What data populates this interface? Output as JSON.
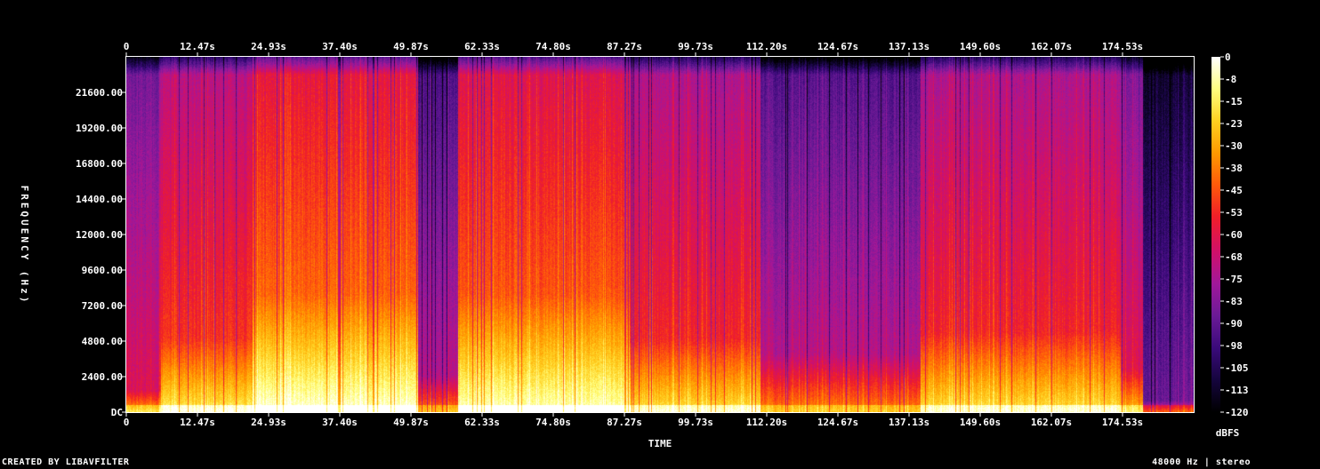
{
  "chart_data": {
    "type": "heatmap",
    "title": "",
    "xlabel": "TIME",
    "ylabel": "FREQUENCY (Hz)",
    "x_ticks": [
      "0",
      "12.47s",
      "24.93s",
      "37.40s",
      "49.87s",
      "62.33s",
      "74.80s",
      "87.27s",
      "99.73s",
      "112.20s",
      "124.67s",
      "137.13s",
      "149.60s",
      "162.07s",
      "174.53s"
    ],
    "y_ticks": [
      "DC",
      "2400.00",
      "4800.00",
      "7200.00",
      "9600.00",
      "12000.00",
      "14400.00",
      "16800.00",
      "19200.00",
      "21600.00"
    ],
    "y_range_hz": [
      0,
      24000
    ],
    "x_range_s": [
      0,
      186.9
    ],
    "colorbar": {
      "unit": "dBFS",
      "ticks": [
        "0",
        "-8",
        "-15",
        "-23",
        "-30",
        "-38",
        "-45",
        "-53",
        "-60",
        "-68",
        "-75",
        "-83",
        "-90",
        "-98",
        "-105",
        "-113",
        "-120"
      ],
      "range": [
        -120,
        0
      ]
    },
    "colormap": [
      "#000000",
      "#15053d",
      "#3a0a7a",
      "#6a1a96",
      "#a0189a",
      "#d0106a",
      "#f01e28",
      "#ff5a0a",
      "#ff9a00",
      "#ffd020",
      "#ffff80",
      "#ffffff"
    ],
    "segments": [
      {
        "start_s": 0,
        "end_s": 6,
        "level": 0.5,
        "bright_hz": 1500
      },
      {
        "start_s": 6,
        "end_s": 22,
        "level": 0.62,
        "bright_hz": 5000
      },
      {
        "start_s": 22,
        "end_s": 51,
        "level": 0.72,
        "bright_hz": 8000
      },
      {
        "start_s": 51,
        "end_s": 58,
        "level": 0.42,
        "bright_hz": 2500
      },
      {
        "start_s": 58,
        "end_s": 88,
        "level": 0.7,
        "bright_hz": 8000
      },
      {
        "start_s": 88,
        "end_s": 111,
        "level": 0.6,
        "bright_hz": 5000
      },
      {
        "start_s": 111,
        "end_s": 139,
        "level": 0.44,
        "bright_hz": 4000
      },
      {
        "start_s": 139,
        "end_s": 174,
        "level": 0.6,
        "bright_hz": 5500
      },
      {
        "start_s": 174,
        "end_s": 178,
        "level": 0.52,
        "bright_hz": 3000
      },
      {
        "start_s": 178,
        "end_s": 186.9,
        "level": 0.28,
        "bright_hz": 800
      }
    ]
  },
  "footer": {
    "left": "CREATED BY LIBAVFILTER",
    "right": "48000 Hz | stereo"
  }
}
